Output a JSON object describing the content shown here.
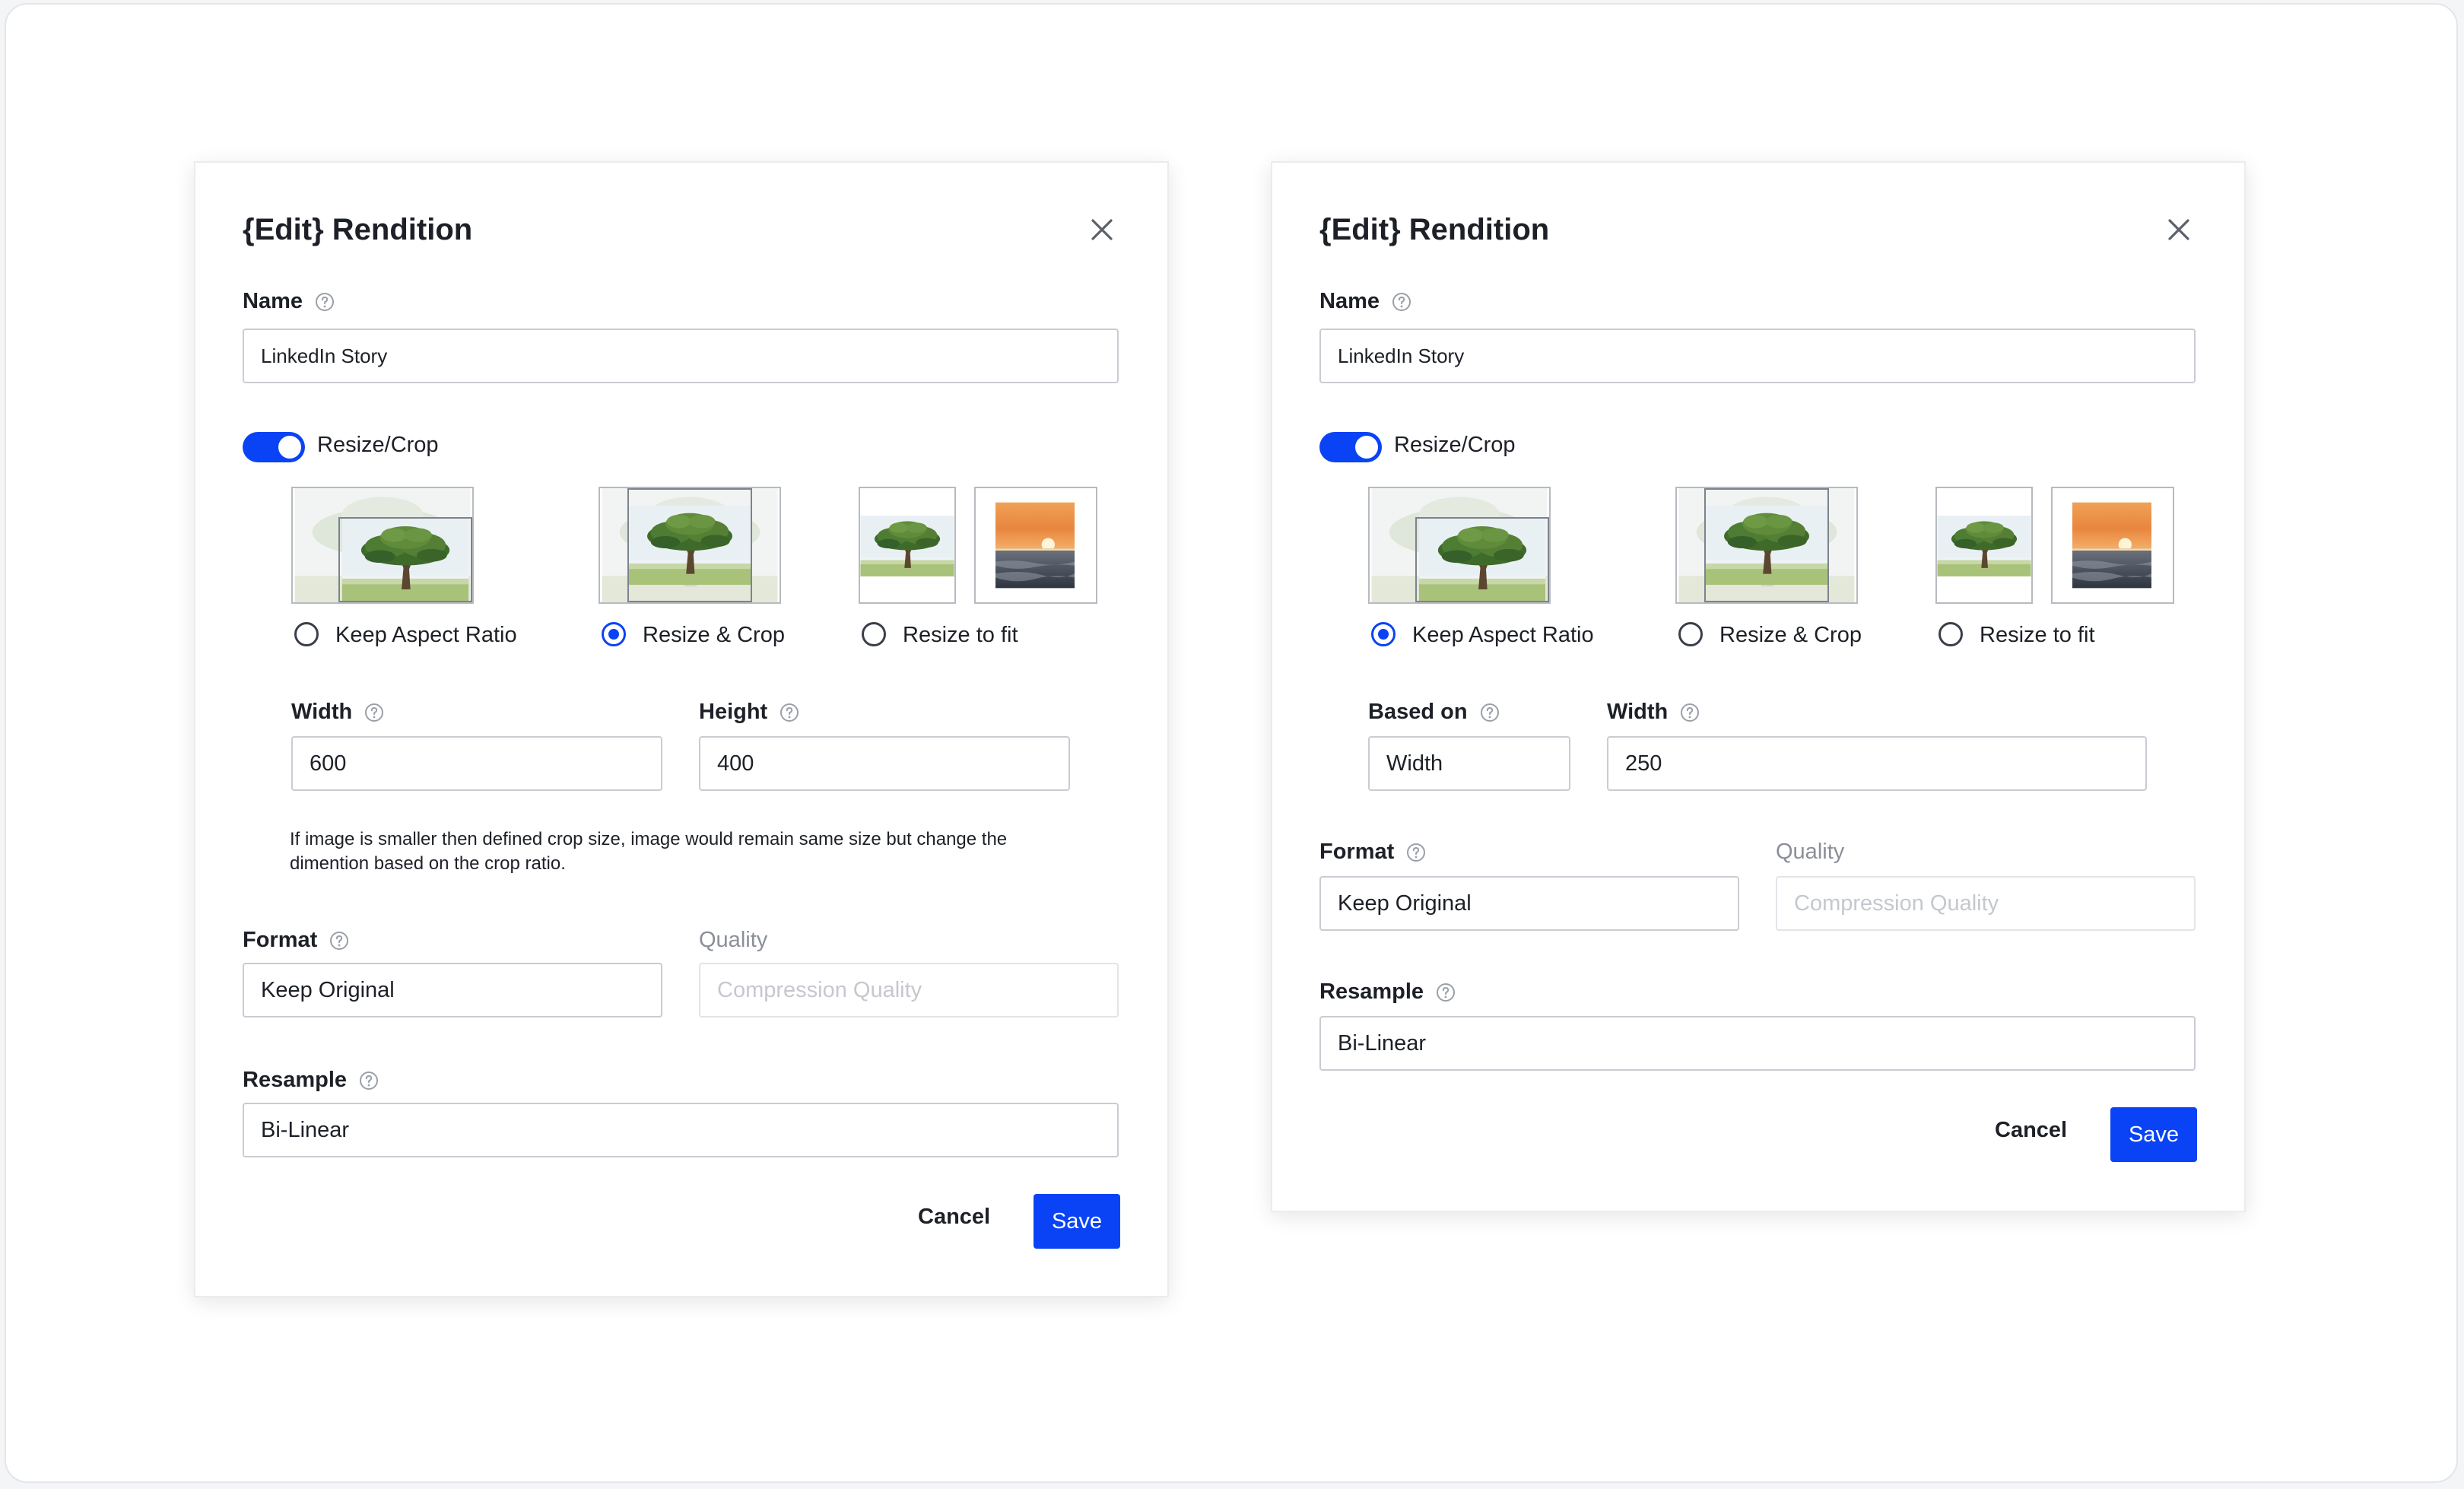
{
  "dialogs": [
    {
      "title": "{Edit} Rendition",
      "name_label": "Name",
      "name_value": "LinkedIn Story",
      "toggle_label": "Resize/Crop",
      "toggle_on": true,
      "options": [
        {
          "label": "Keep Aspect Ratio",
          "selected": false
        },
        {
          "label": "Resize & Crop",
          "selected": true
        },
        {
          "label": "Resize to fit",
          "selected": false
        }
      ],
      "dim1_label": "Width",
      "dim1_value": "600",
      "dim2_label": "Height",
      "dim2_value": "400",
      "note": "If image is smaller then defined crop size, image would remain same size but change the dimention based on the crop ratio.",
      "format_label": "Format",
      "format_value": "Keep Original",
      "quality_label": "Quality",
      "quality_placeholder": "Compression Quality",
      "resample_label": "Resample",
      "resample_value": "Bi-Linear",
      "cancel_label": "Cancel",
      "save_label": "Save"
    },
    {
      "title": "{Edit} Rendition",
      "name_label": "Name",
      "name_value": "LinkedIn Story",
      "toggle_label": "Resize/Crop",
      "toggle_on": true,
      "options": [
        {
          "label": "Keep Aspect Ratio",
          "selected": true
        },
        {
          "label": "Resize & Crop",
          "selected": false
        },
        {
          "label": "Resize to fit",
          "selected": false
        }
      ],
      "dim1_label": "Based on",
      "dim1_value": "Width",
      "dim2_label": "Width",
      "dim2_value": "250",
      "format_label": "Format",
      "format_value": "Keep Original",
      "quality_label": "Quality",
      "quality_placeholder": "Compression Quality",
      "resample_label": "Resample",
      "resample_value": "Bi-Linear",
      "cancel_label": "Cancel",
      "save_label": "Save"
    }
  ],
  "colors": {
    "primary": "#0a43f5",
    "text": "#1d2027",
    "muted": "#8a8f98",
    "border": "#c9ccd2"
  },
  "icons": [
    "close-icon",
    "help-icon",
    "tree-thumbnail",
    "sunset-thumbnail"
  ]
}
